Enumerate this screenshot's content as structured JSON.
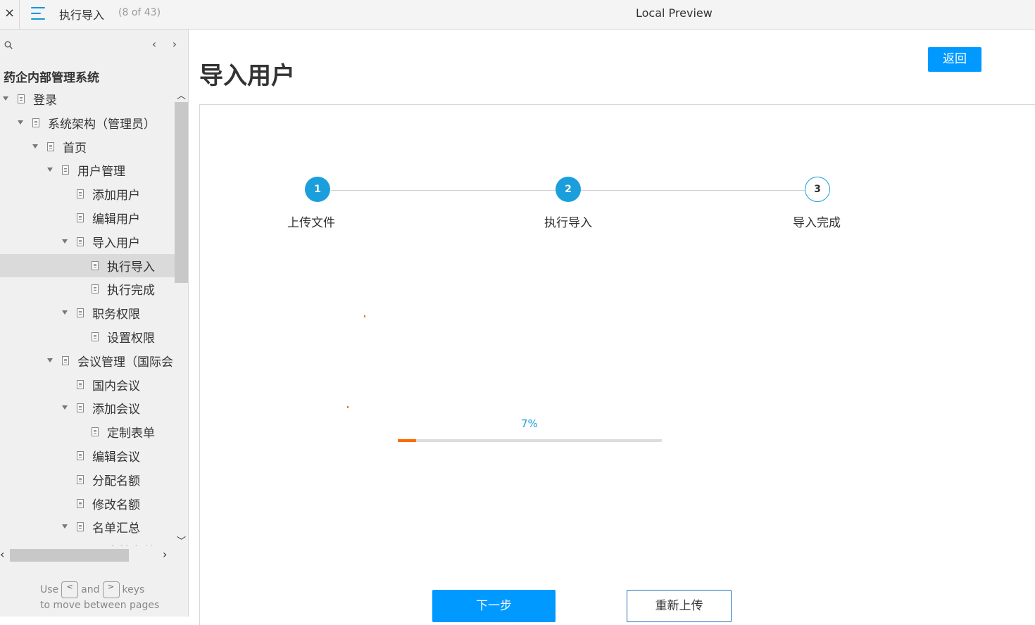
{
  "topbar": {
    "close_icon": "×",
    "page_name": "执行导入",
    "page_count": "(8 of 43)",
    "preview_title": "Local Preview"
  },
  "sidebar": {
    "prev_icon": "‹",
    "next_icon": "›",
    "project_title": "药企内部管理系统",
    "items": [
      {
        "label": "登录",
        "level": 0,
        "expanded": true
      },
      {
        "label": "系统架构（管理员）",
        "level": 1,
        "expanded": true
      },
      {
        "label": "首页",
        "level": 2,
        "expanded": true
      },
      {
        "label": "用户管理",
        "level": 3,
        "expanded": true
      },
      {
        "label": "添加用户",
        "level": 4,
        "expanded": false
      },
      {
        "label": "编辑用户",
        "level": 4,
        "expanded": false
      },
      {
        "label": "导入用户",
        "level": 4,
        "expanded": true
      },
      {
        "label": "执行导入",
        "level": 5,
        "expanded": false,
        "selected": true
      },
      {
        "label": "执行完成",
        "level": 5,
        "expanded": false
      },
      {
        "label": "职务权限",
        "level": 4,
        "expanded": true
      },
      {
        "label": "设置权限",
        "level": 5,
        "expanded": false
      },
      {
        "label": "会议管理（国际会",
        "level": 3,
        "expanded": true
      },
      {
        "label": "国内会议",
        "level": 4,
        "expanded": false
      },
      {
        "label": "添加会议",
        "level": 4,
        "expanded": true
      },
      {
        "label": "定制表单",
        "level": 5,
        "expanded": false
      },
      {
        "label": "编辑会议",
        "level": 4,
        "expanded": false
      },
      {
        "label": "分配名额",
        "level": 4,
        "expanded": false
      },
      {
        "label": "修改名额",
        "level": 4,
        "expanded": false
      },
      {
        "label": "名单汇总",
        "level": 4,
        "expanded": true
      },
      {
        "label": "审核名单",
        "level": 5,
        "expanded": false
      }
    ],
    "hint": {
      "use": "Use",
      "and": "and",
      "keys": "keys",
      "line2": "to move between pages",
      "key_left": "<",
      "key_right": ">"
    }
  },
  "main": {
    "title": "导入用户",
    "back_label": "返回",
    "steps": [
      {
        "number": "1",
        "label": "上传文件",
        "state": "done"
      },
      {
        "number": "2",
        "label": "执行导入",
        "state": "done"
      },
      {
        "number": "3",
        "label": "导入完成",
        "state": "todo"
      }
    ],
    "progress": {
      "text": "7%",
      "value": 0.07
    },
    "next_label": "下一步",
    "reupload_label": "重新上传",
    "colors": {
      "primary": "#0099ff",
      "step": "#1a9fdc",
      "progress": "#ff6a00"
    }
  }
}
